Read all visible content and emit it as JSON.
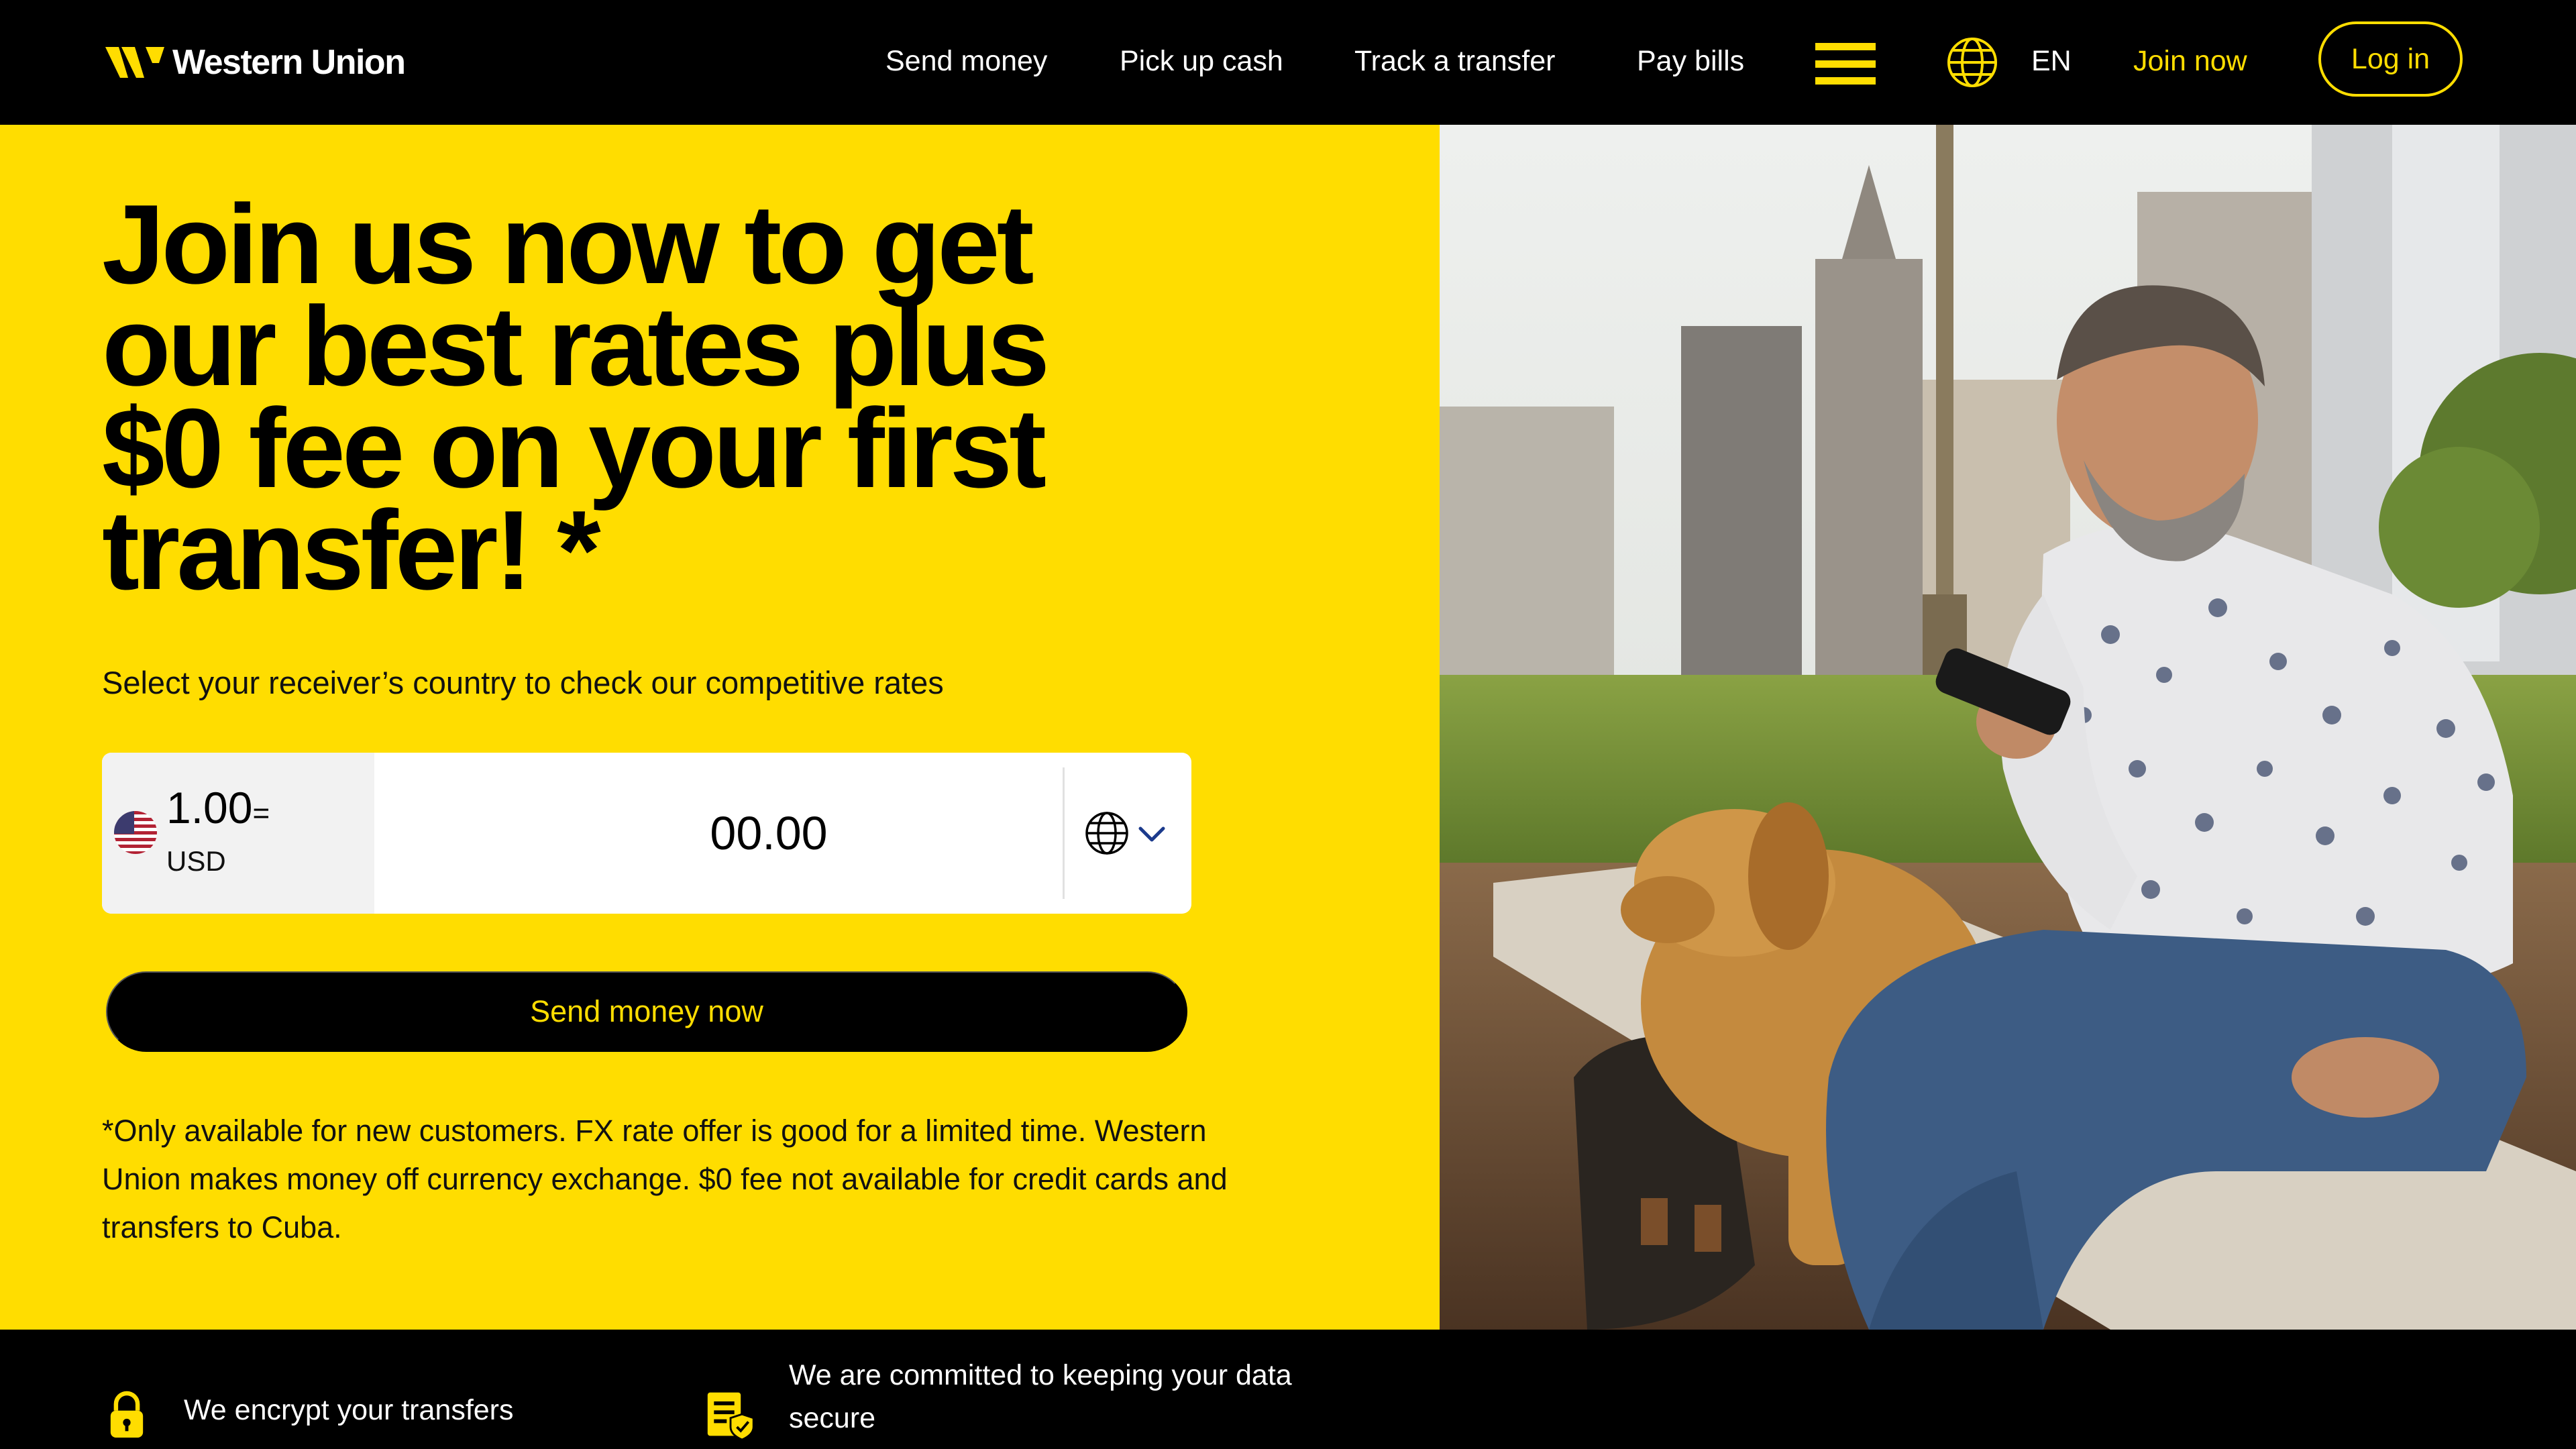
{
  "brand": {
    "name": "Western Union",
    "accent": "#FFDD00",
    "dark": "#000000"
  },
  "nav": {
    "links": [
      "Send money",
      "Pick up cash",
      "Track a transfer",
      "Pay bills"
    ],
    "menu_icon": "hamburger-icon",
    "language_icon": "globe-icon",
    "language": "EN",
    "join": "Join now",
    "login": "Log in"
  },
  "hero": {
    "headline": "Join us now to get our best rates plus $0 fee on your first transfer! *",
    "subline": "Select your receiver’s country to check our competitive rates",
    "converter": {
      "send_amount": "1.00",
      "equals": "=",
      "send_currency": "USD",
      "send_flag": "us-flag-icon",
      "receive_amount": "00.00",
      "receive_country_icon": "globe-icon",
      "dropdown_icon": "chevron-down-icon"
    },
    "cta": "Send money now",
    "disclaimer": "*Only available for new customers. FX rate offer is good for a limited time. Western Union makes money off currency exchange. $0 fee not available for credit cards and transfers to Cuba."
  },
  "trust": {
    "items": [
      {
        "icon": "lock-icon",
        "text": "We encrypt your transfers"
      },
      {
        "icon": "secure-document-icon",
        "text": "We are committed to keeping your data secure"
      }
    ]
  }
}
